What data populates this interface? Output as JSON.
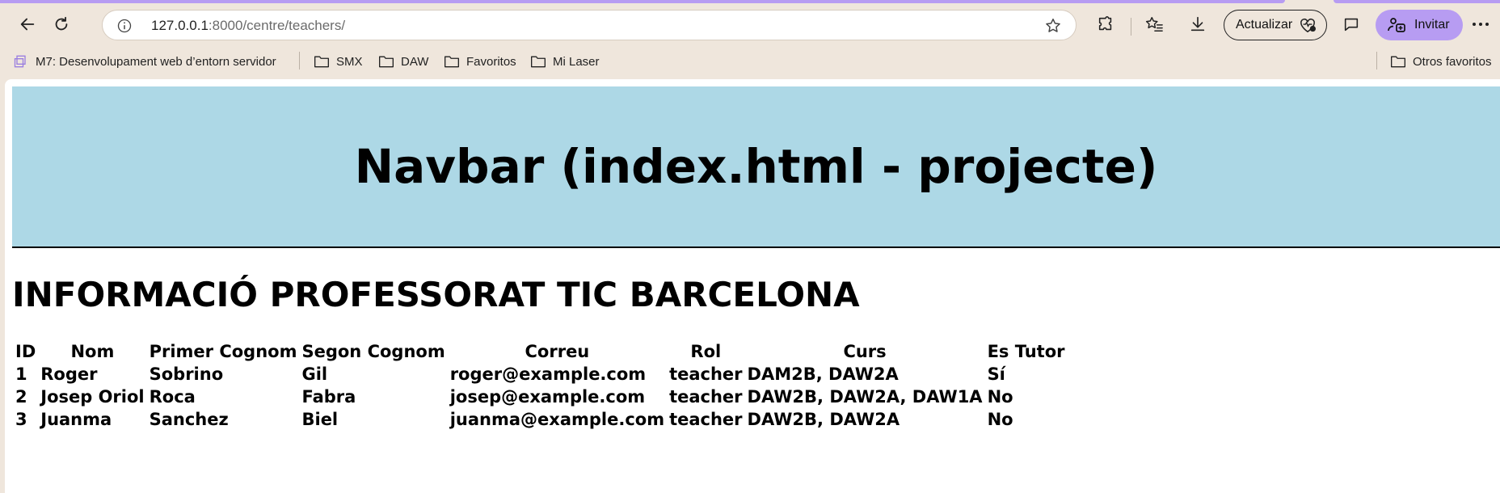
{
  "browser": {
    "url_host": "127.0.0.1",
    "url_rest": ":8000/centre/teachers/",
    "update_label": "Actualizar",
    "invite_label": "Invitar",
    "accent_color": "#b79cf2"
  },
  "bookmarks": {
    "items": [
      {
        "label": "M7: Desenvolupament web d’entorn servidor",
        "icon": "app-icon"
      },
      {
        "label": "SMX",
        "icon": "folder-icon"
      },
      {
        "label": "DAW",
        "icon": "folder-icon"
      },
      {
        "label": "Favoritos",
        "icon": "folder-icon"
      },
      {
        "label": "Mi Laser",
        "icon": "folder-icon"
      }
    ],
    "other": "Otros favoritos"
  },
  "page": {
    "navbar_title": "Navbar (index.html - projecte)",
    "navbar_color": "#add8e6",
    "heading": "INFORMACIÓ PROFESSORAT TIC BARCELONA",
    "table": {
      "headers": [
        "ID",
        "Nom",
        "Primer Cognom",
        "Segon Cognom",
        "Correu",
        "Rol",
        "Curs",
        "Es Tutor"
      ],
      "rows": [
        [
          "1",
          "Roger",
          "Sobrino",
          "Gil",
          "roger@example.com",
          "teacher",
          "DAM2B, DAW2A",
          "Sí"
        ],
        [
          "2",
          "Josep Oriol",
          "Roca",
          "Fabra",
          "josep@example.com",
          "teacher",
          "DAW2B, DAW2A, DAW1A",
          "No"
        ],
        [
          "3",
          "Juanma",
          "Sanchez",
          "Biel",
          "juanma@example.com",
          "teacher",
          "DAW2B, DAW2A",
          "No"
        ]
      ]
    }
  }
}
